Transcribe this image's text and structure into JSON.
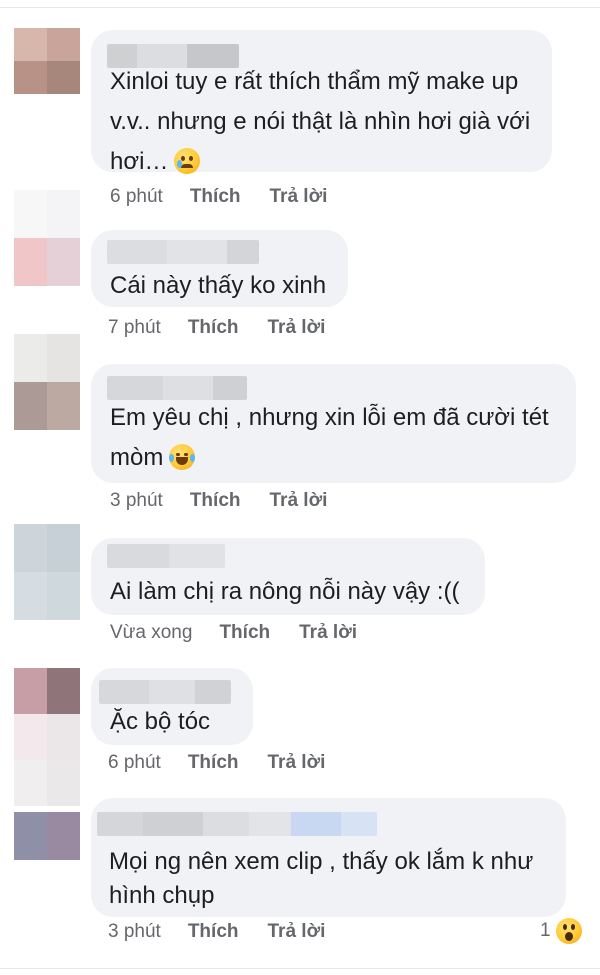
{
  "comments": [
    {
      "lines": [
        "Xinloi tuy e rất thích thẩm mỹ make up",
        "v.v.. nhưng e nói thật là nhìn hơi già với",
        "hơi…"
      ],
      "emoji": "crying-face",
      "time": "6 phút",
      "like": "Thích",
      "reply": "Trả lời"
    },
    {
      "lines": [
        "Cái này thấy ko xinh"
      ],
      "time": "7 phút",
      "like": "Thích",
      "reply": "Trả lời"
    },
    {
      "lines": [
        "Em yêu chị , nhưng xin lỗi em đã cười tét",
        "mòm"
      ],
      "emoji": "tears-of-joy",
      "time": "3 phút",
      "like": "Thích",
      "reply": "Trả lời"
    },
    {
      "lines": [
        "Ai làm chị ra nông nỗi này vậy :(("
      ],
      "time": "Vừa xong",
      "like": "Thích",
      "reply": "Trả lời"
    },
    {
      "lines": [
        "Ặc bộ tóc"
      ],
      "time": "6 phút",
      "like": "Thích",
      "reply": "Trả lời"
    },
    {
      "lines": [
        "Mọi ng nên xem clip , thấy ok lắm k như",
        "hình chụp"
      ],
      "time": "3 phút",
      "like": "Thích",
      "reply": "Trả lời",
      "reaction_count": "1",
      "reaction_icon": "wow-face"
    }
  ],
  "colors": {
    "bubble": "#f0f2f5",
    "text": "#1c1e21",
    "meta": "#65676b"
  }
}
